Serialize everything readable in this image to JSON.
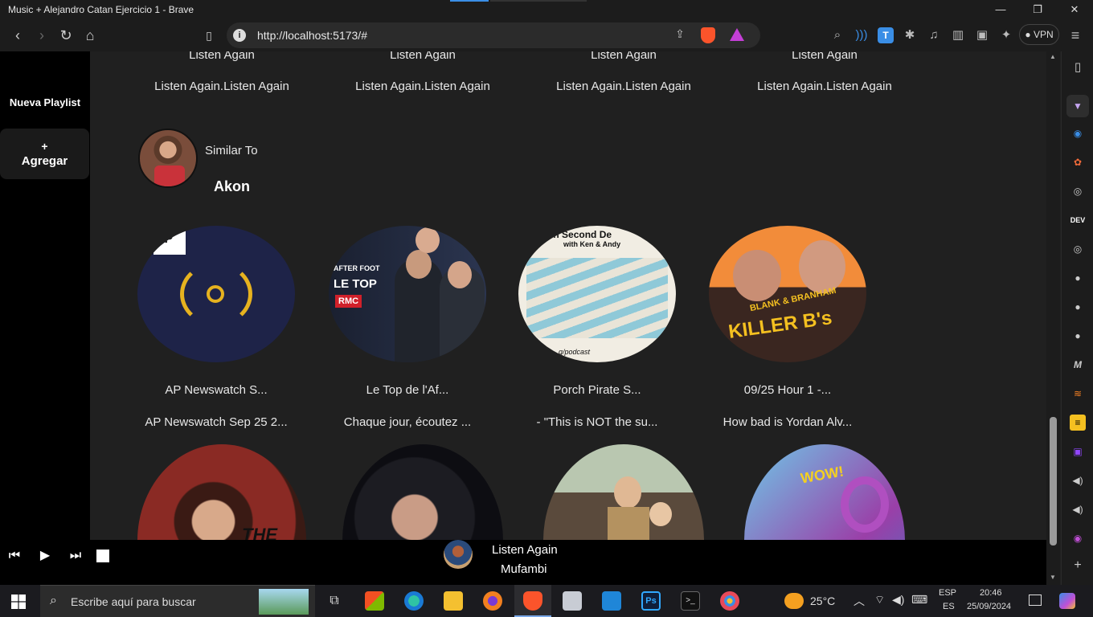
{
  "window": {
    "title": "Music + Alejandro Catan Ejercicio 1 - Brave",
    "min": "—",
    "max": "❐",
    "close": "✕"
  },
  "browser": {
    "url": "http://localhost:5173/#",
    "vpn_label": "VPN"
  },
  "sidebar": {
    "new_playlist": "Nueva Playlist",
    "add_plus": "+",
    "add_label": "Agregar"
  },
  "top_row": {
    "titles": [
      "Listen Again",
      "Listen Again",
      "Listen Again",
      "Listen Again"
    ],
    "subtitles": [
      "Listen Again.Listen Again",
      "Listen Again.Listen Again",
      "Listen Again.Listen Again",
      "Listen Again.Listen Again"
    ]
  },
  "similar": {
    "heading": "Similar To",
    "artist": "Akon"
  },
  "cards": [
    {
      "title": "AP Newswatch S...",
      "subtitle": "AP Newswatch Sep 25 2...",
      "art": "AP"
    },
    {
      "title": "Le Top de l'Af...",
      "subtitle": "Chaque jour, écoutez ...",
      "art_line1": "AFTER FOOT",
      "art_line2": "LE TOP",
      "art_line3": "RMC"
    },
    {
      "title": "Porch Pirate S...",
      "subtitle": "- \"This is NOT the su...",
      "art_line1": "ven Second De",
      "art_line2": "with Ken & Andy",
      "art_line3": "g/podcast"
    },
    {
      "title": "09/25 Hour 1 -...",
      "subtitle": "How bad is Yordan Alv...",
      "art_line1": "BLANK & BRANHAM",
      "art_line2": "KILLER B's"
    }
  ],
  "bottom_cards": [
    {
      "art": "THE"
    },
    {
      "art": ""
    },
    {
      "art": ""
    },
    {
      "art": "WOW!"
    }
  ],
  "player": {
    "track": "Listen Again",
    "artist": "Mufambi"
  },
  "taskbar": {
    "search_placeholder": "Escribe aquí para buscar",
    "weather": "25°C",
    "lang1": "ESP",
    "lang2": "ES",
    "time": "20:46",
    "date": "25/09/2024"
  },
  "colors": {
    "accent_blue": "#3a8ee6",
    "brave_orange": "#fb542b",
    "bg_main": "#202020"
  }
}
